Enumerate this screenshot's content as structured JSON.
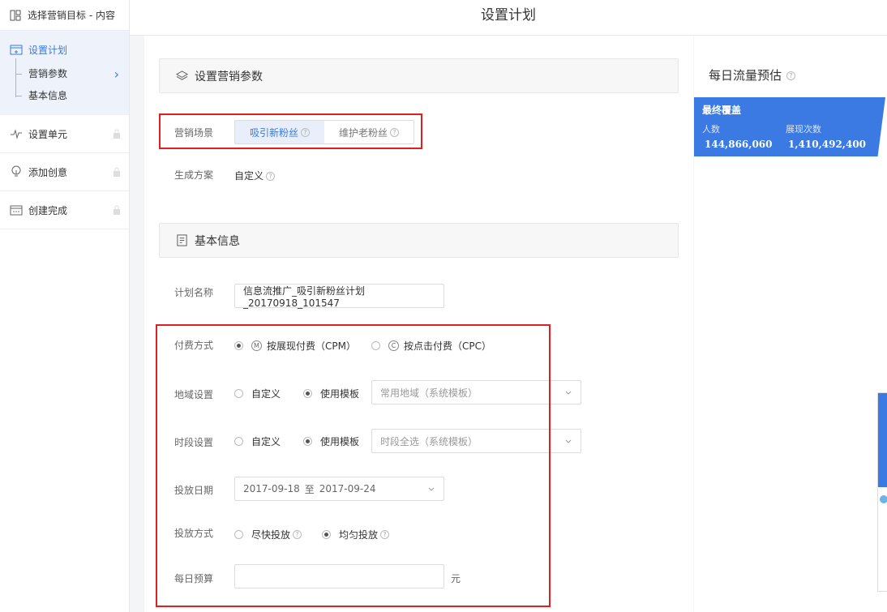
{
  "sidebar": {
    "top": "选择营销目标 - 内容",
    "active": "设置计划",
    "subitems": [
      "营销参数",
      "基本信息"
    ],
    "items": [
      "设置单元",
      "添加创意",
      "创建完成"
    ]
  },
  "header": {
    "title": "设置计划"
  },
  "marketing": {
    "section_title": "设置营销参数",
    "scene_label": "营销场景",
    "scene_options": [
      "吸引新粉丝",
      "维护老粉丝"
    ],
    "plan_label": "生成方案",
    "plan_value": "自定义"
  },
  "basic": {
    "section_title": "基本信息",
    "name_label": "计划名称",
    "name_value": "信息流推广_吸引新粉丝计划_20170918_101547",
    "pay_label": "付费方式",
    "pay_options": [
      {
        "badge": "M",
        "label": "按展现付费（CPM）"
      },
      {
        "badge": "C",
        "label": "按点击付费（CPC）"
      }
    ],
    "region_label": "地域设置",
    "region_options": [
      "自定义",
      "使用模板"
    ],
    "region_template": "常用地域（系统模板）",
    "time_label": "时段设置",
    "time_options": [
      "自定义",
      "使用模板"
    ],
    "time_template": "时段全选（系统模板）",
    "date_label": "投放日期",
    "date_start": "2017-09-18",
    "date_sep": "至",
    "date_end": "2017-09-24",
    "delivery_label": "投放方式",
    "delivery_options": [
      "尽快投放",
      "均匀投放"
    ],
    "budget_label": "每日预算",
    "budget_value": "",
    "budget_unit": "元"
  },
  "forecast": {
    "title": "每日流量预估",
    "card_title": "最终覆盖",
    "people_label": "人数",
    "people_value": "144,866,060",
    "views_label": "展现次数",
    "views_value": "1,410,492,400"
  },
  "colors": {
    "accent": "#3b7ae2",
    "highlight": "#e02020"
  }
}
